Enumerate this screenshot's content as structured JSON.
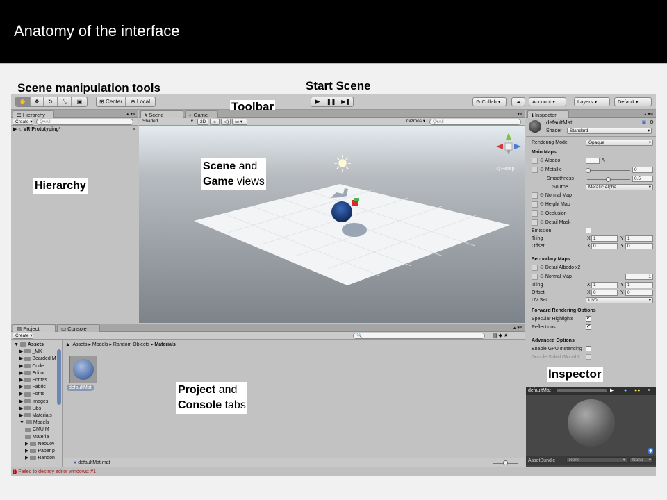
{
  "banner": {
    "title": "Anatomy of the interface"
  },
  "annotations": {
    "scene_tools": "Scene manipulation tools",
    "start_scene": "Start Scene",
    "toolbar": "Toolbar",
    "hierarchy": "Hierarchy",
    "scene_bold": "Scene",
    "scene_rest": " and",
    "game_bold": "Game",
    "game_rest": " views",
    "project_bold": "Project",
    "project_rest": " and",
    "console_bold": "Console",
    "console_rest": " tabs",
    "inspector": "Inspector"
  },
  "toolbar": {
    "pivot": "Center",
    "space": "Local",
    "collab": "Collab",
    "account": "Account",
    "layers": "Layers",
    "layout": "Default"
  },
  "hierarchy": {
    "tab": "Hierarchy",
    "create": "Create",
    "search": "Q▾All",
    "scene_name": "VR Prototyping*"
  },
  "scene_view": {
    "tab_scene": "Scene",
    "tab_game": "Game",
    "shading": "Shaded",
    "mode_2d": "2D",
    "gizmos": "Gizmos",
    "search": "Q▾All",
    "persp": "◁ Persp"
  },
  "inspector": {
    "tab": "Inspector",
    "material_name": "defaultMat",
    "shader_label": "Shader",
    "shader_value": "Standard",
    "rendering_mode_label": "Rendering Mode",
    "rendering_mode_value": "Opaque",
    "main_maps": "Main Maps",
    "albedo": "Albedo",
    "metallic": "Metallic",
    "metallic_value": "0",
    "smoothness": "Smoothness",
    "smoothness_value": "0.5",
    "source_label": "Source",
    "source_value": "Metallic Alpha",
    "normal_map": "Normal Map",
    "height_map": "Height Map",
    "occlusion": "Occlusion",
    "detail_mask": "Detail Mask",
    "emission": "Emission",
    "tiling": "Tiling",
    "offset": "Offset",
    "x": "X",
    "y": "Y",
    "tiling_x": "1",
    "tiling_y": "1",
    "offset_x": "0",
    "offset_y": "0",
    "secondary_maps": "Secondary Maps",
    "detail_albedo": "Detail Albedo x2",
    "sec_normal_map": "Normal Map",
    "sec_normal_value": "1",
    "sec_tiling_x": "1",
    "sec_tiling_y": "1",
    "sec_offset_x": "0",
    "sec_offset_y": "0",
    "uv_set_label": "UV Set",
    "uv_set_value": "UV0",
    "forward_options": "Forward Rendering Options",
    "specular_highlights": "Specular Highlights",
    "reflections": "Reflections",
    "advanced_options": "Advanced Options",
    "gpu_instancing": "Enable GPU Instancing",
    "double_sided": "Double Sided Global Il",
    "preview_title": "defaultMat",
    "asset_bundle_label": "AssetBundle",
    "asset_bundle_value": "None",
    "asset_bundle_variant": "None"
  },
  "project": {
    "tab_project": "Project",
    "tab_console": "Console",
    "create": "Create",
    "breadcrumb": [
      "Assets",
      "Models",
      "Random Objects",
      "Materials"
    ],
    "tree": [
      {
        "label": "Assets",
        "level": 0,
        "bold": true
      },
      {
        "label": "_MK",
        "level": 1
      },
      {
        "label": "Bearded M",
        "level": 1
      },
      {
        "label": "Code",
        "level": 1
      },
      {
        "label": "Editor",
        "level": 1
      },
      {
        "label": "Entitas",
        "level": 1
      },
      {
        "label": "Fabric",
        "level": 1
      },
      {
        "label": "Fonts",
        "level": 1
      },
      {
        "label": "Images",
        "level": 1
      },
      {
        "label": "Libs",
        "level": 1
      },
      {
        "label": "Materials",
        "level": 1
      },
      {
        "label": "Models",
        "level": 1
      },
      {
        "label": "CMU M",
        "level": 2
      },
      {
        "label": "Materia",
        "level": 2
      },
      {
        "label": "NeoLov",
        "level": 2
      },
      {
        "label": "Paper p",
        "level": 2
      },
      {
        "label": "Randon",
        "level": 2
      }
    ],
    "asset_name": "defaultMat",
    "footer_file": "defaultMat.mat"
  },
  "status": {
    "message": "Failed to destroy editor windows: #1"
  },
  "colors": {
    "banner": "#000000",
    "editor_bg": "#c2c2c2",
    "scene_sky": "#8a8f96",
    "sphere": "#1e3f7a",
    "error": "#cc0000"
  }
}
